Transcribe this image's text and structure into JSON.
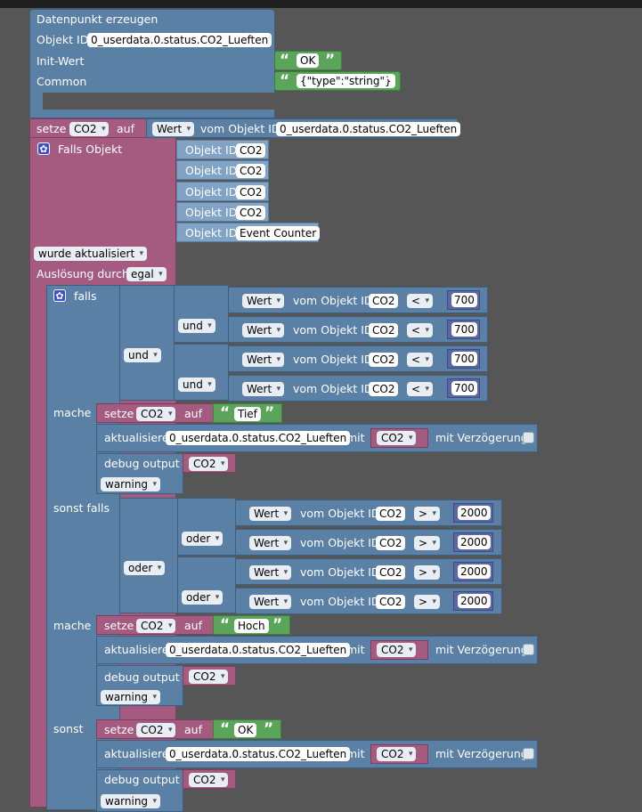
{
  "create": {
    "title": "Datenpunkt erzeugen",
    "obj_label": "Objekt ID",
    "obj_value": "0_userdata.0.status.CO2_Lueften",
    "init_label": "Init-Wert",
    "init_value": "OK",
    "common_label": "Common",
    "common_value": "{\"type\":\"string\"}"
  },
  "set_var": {
    "setze": "setze",
    "var": "CO2",
    "auf": "auf",
    "wert": "Wert",
    "vom": "vom Objekt ID",
    "obj": "0_userdata.0.status.CO2_Lueften"
  },
  "trigger": {
    "falls_objekt": "Falls Objekt",
    "obj_label": "Objekt ID",
    "objs": [
      "CO2",
      "CO2",
      "CO2",
      "CO2",
      "Event Counter"
    ],
    "event": "wurde aktualisiert",
    "ausloesung": "Auslösung durch",
    "egal": "egal"
  },
  "common": {
    "wert": "Wert",
    "vom": "vom Objekt ID",
    "co2": "CO2",
    "setze": "setze",
    "auf": "auf",
    "aktualisiere": "aktualisiere",
    "path": "0_userdata.0.status.CO2_Lueften",
    "mit": "mit",
    "mitv": "mit Verzögerung",
    "debug": "debug output",
    "warning": "warning"
  },
  "ifblock": {
    "falls": "falls",
    "mache": "mache",
    "sonst_falls": "sonst falls",
    "sonst": "sonst",
    "und": "und",
    "oder": "oder",
    "lt": "<",
    "gt": ">",
    "v700": "700",
    "v2000": "2000",
    "tief": "Tief",
    "hoch": "Hoch",
    "ok": "OK"
  }
}
